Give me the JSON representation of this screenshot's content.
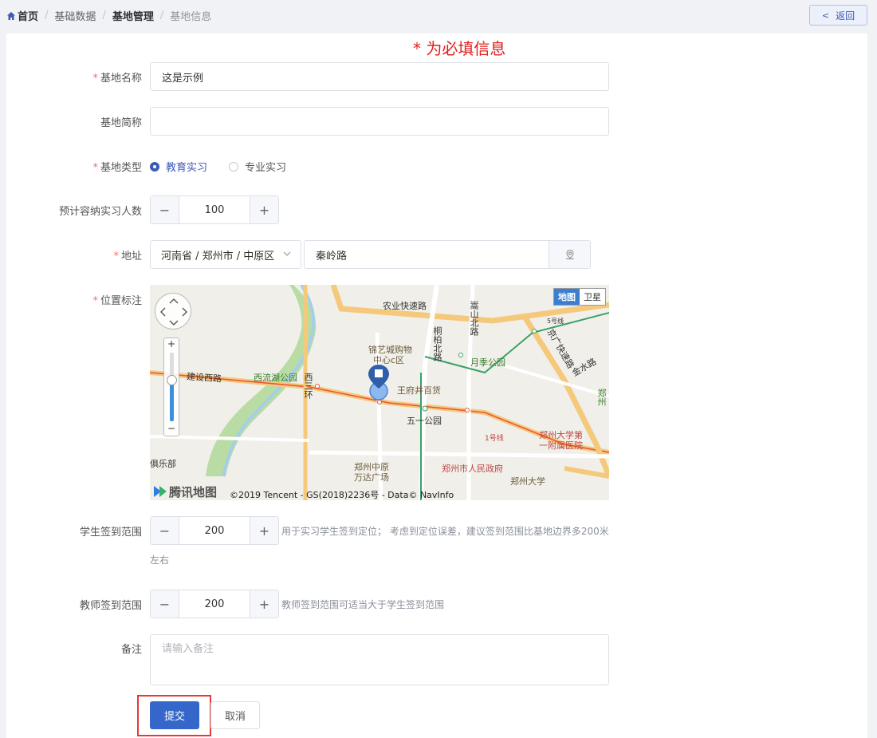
{
  "breadcrumb": {
    "home": "首页",
    "items": [
      "基础数据",
      "基地管理",
      "基地信息"
    ]
  },
  "back_label": "返回",
  "required_note": "* 为必填信息",
  "form": {
    "name": {
      "label": "基地名称",
      "value": "这是示例",
      "required": true
    },
    "short_name": {
      "label": "基地简称",
      "value": ""
    },
    "type": {
      "label": "基地类型",
      "required": true,
      "options": [
        "教育实习",
        "专业实习"
      ],
      "selected": "教育实习"
    },
    "capacity": {
      "label": "预计容纳实习人数",
      "value": "100"
    },
    "address": {
      "label": "地址",
      "required": true,
      "region": "河南省 / 郑州市 / 中原区",
      "street": "秦岭路"
    },
    "location": {
      "label": "位置标注",
      "required": true
    },
    "student_range": {
      "label": "学生签到范围",
      "value": "200",
      "hint_line1": "用于实习学生签到定位； 考虑到定位误差，建议签到范围比基地边界多200米",
      "hint_line2": "左右"
    },
    "teacher_range": {
      "label": "教师签到范围",
      "value": "200",
      "hint": "教师签到范围可适当大于学生签到范围"
    },
    "remark": {
      "label": "备注",
      "placeholder": "请输入备注"
    }
  },
  "map": {
    "type_buttons": [
      "地图",
      "卫星"
    ],
    "active_type": "地图",
    "zoom_level": 0.6,
    "logo": "腾讯地图",
    "attribution": "©2019 Tencent - GS(2018)2236号 - Data© NavInfo",
    "labels": {
      "agri_road": "农业快速路",
      "songshan": "嵩山北路",
      "tongbai": "桐柏北路",
      "jinyicheng": "锦艺城购物",
      "jinyicheng2": "中心c区",
      "yueji": "月季公园",
      "jingguang": "京广快速路",
      "jinshui": "金水路",
      "jianshe": "建设西路",
      "xiliu": "西流湖公园",
      "xisan": "西三环",
      "wangfujing": "王府井百货",
      "wuyi": "五一公园",
      "line1": "1号线",
      "line5": "5号线",
      "zdyfy": "郑州大学第一附属医院",
      "zhongyuan": "郑州中原万达广场",
      "gov": "郑州市人民政府",
      "zzu": "郑州大学",
      "club": "俱乐部",
      "zhengzhou": "郑州"
    }
  },
  "buttons": {
    "submit": "提交",
    "cancel": "取消"
  },
  "colors": {
    "primary": "#3467c9",
    "required": "#e02020",
    "highlight_box": "#e53935"
  }
}
